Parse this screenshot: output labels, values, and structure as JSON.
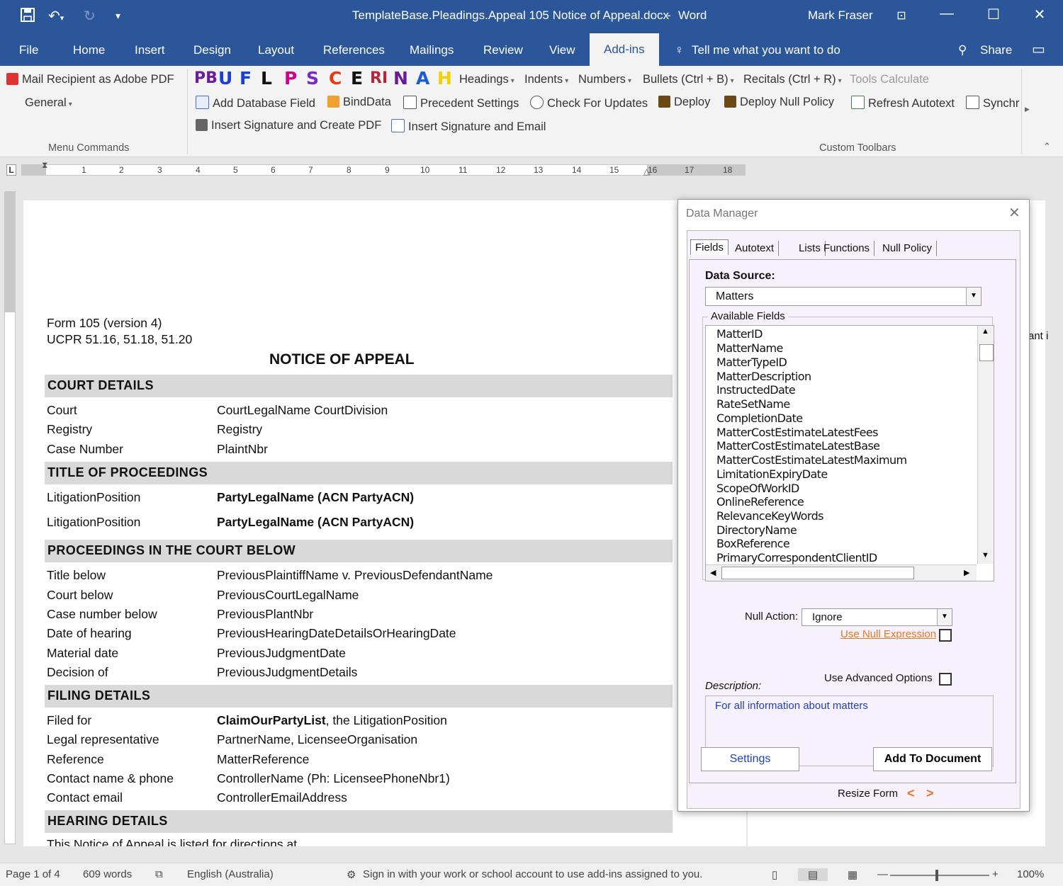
{
  "window": {
    "title": "TemplateBase.Pleadings.Appeal 105 Notice of Appeal.docx",
    "app": "Word",
    "user": "Mark Fraser"
  },
  "tabs": [
    "File",
    "Home",
    "Insert",
    "Design",
    "Layout",
    "References",
    "Mailings",
    "Review",
    "View",
    "Add-ins"
  ],
  "active_tab": "Add-ins",
  "tellme": "Tell me what you want to do",
  "share": "Share",
  "ribbon": {
    "menu_commands": {
      "mail_recipient": "Mail Recipient as Adobe PDF",
      "general": "General",
      "label": "Menu Commands"
    },
    "letters": [
      "PB",
      "U",
      "F",
      "L",
      "P",
      "S",
      "C",
      "E",
      "RI",
      "N",
      "A",
      "H"
    ],
    "row1": {
      "headings": "Headings",
      "indents": "Indents",
      "numbers": "Numbers",
      "bullets": "Bullets (Ctrl + B)",
      "recitals": "Recitals (Ctrl + R)",
      "tools_calculate": "Tools Calculate"
    },
    "row2": {
      "add_db_field": "Add Database Field",
      "bind_data": "BindData",
      "precedent_settings": "Precedent Settings",
      "check_updates": "Check For Updates",
      "deploy": "Deploy",
      "deploy_null": "Deploy Null Policy",
      "refresh_autotext": "Refresh Autotext",
      "synch": "Synchr"
    },
    "row3": {
      "insert_sig_pdf": "Insert Signature and Create PDF",
      "insert_sig_email": "Insert Signature and Email"
    },
    "custom_label": "Custom Toolbars"
  },
  "ruler_numbers": [
    "1",
    "2",
    "3",
    "4",
    "5",
    "6",
    "7",
    "8",
    "9",
    "10",
    "11",
    "12",
    "13",
    "14",
    "15",
    "16",
    "17",
    "18"
  ],
  "document": {
    "form_line1": "Form 105 (version 4)",
    "form_line2": "UCPR 51.16, 51.18, 51.20",
    "title": "NOTICE OF APPEAL",
    "sections": {
      "court_details": "COURT DETAILS",
      "title_of_proceedings": "TITLE OF PROCEEDINGS",
      "court_below": "PROCEEDINGS IN THE COURT BELOW",
      "filing": "FILING DETAILS",
      "hearing": "HEARING DETAILS"
    },
    "court": [
      {
        "label": "Court",
        "value": "CourtLegalName CourtDivision"
      },
      {
        "label": "Registry",
        "value": "Registry"
      },
      {
        "label": "Case Number",
        "value": "PlaintNbr"
      }
    ],
    "parties": [
      {
        "label": "LitigationPosition",
        "value": "PartyLegalName (ACN PartyACN)"
      },
      {
        "label": "LitigationPosition",
        "value": "PartyLegalName (ACN PartyACN)"
      }
    ],
    "below": [
      {
        "label": "Title below",
        "value": "PreviousPlaintiffName v. PreviousDefendantName"
      },
      {
        "label": "Court below",
        "value": "PreviousCourtLegalName"
      },
      {
        "label": "Case number below",
        "value": "PreviousPlantNbr"
      },
      {
        "label": "Date of hearing",
        "value": "PreviousHearingDateDetailsOrHearingDate"
      },
      {
        "label": "Material date",
        "value": "PreviousJudgmentDate"
      },
      {
        "label": "Decision of",
        "value": "PreviousJudgmentDetails"
      }
    ],
    "filing": [
      {
        "label": "Filed for",
        "value_bold": "ClaimOurPartyList",
        "value": ", the LitigationPosition"
      },
      {
        "label": "Legal representative",
        "value": "PartnerName, LicenseeOrganisation"
      },
      {
        "label": "Reference",
        "value": "MatterReference"
      },
      {
        "label": "Contact name & phone",
        "value": "ControllerName (Ph:  LicenseePhoneNbr1)"
      },
      {
        "label": "Contact email",
        "value": "ControllerEmailAddress"
      }
    ],
    "hearing_text": "This Notice of Appeal is listed for directions at",
    "right_fragment": "ant i"
  },
  "dialog": {
    "title": "Data Manager",
    "tabs": [
      "Fields",
      "Autotext",
      "Lists",
      "Functions",
      "Null Policy"
    ],
    "data_source_label": "Data Source:",
    "data_source": "Matters",
    "available_fields_label": "Available Fields",
    "fields": [
      "MatterID",
      "MatterName",
      "MatterTypeID",
      "MatterDescription",
      "InstructedDate",
      "RateSetName",
      "CompletionDate",
      "MatterCostEstimateLatestFees",
      "MatterCostEstimateLatestBase",
      "MatterCostEstimateLatestMaximum",
      "LimitationExpiryDate",
      "ScopeOfWorkID",
      "OnlineReference",
      "RelevanceKeyWords",
      "DirectoryName",
      "BoxReference",
      "PrimaryCorrespondentClientID"
    ],
    "null_action_label": "Null Action:",
    "null_action": "Ignore",
    "use_null_expression": "Use Null Expression",
    "use_advanced": "Use Advanced Options",
    "description_label": "Description:",
    "description": "For all information about matters",
    "settings": "Settings",
    "add_to_document": "Add To Document",
    "resize_form": "Resize Form",
    "resize_left": "<",
    "resize_right": ">"
  },
  "status": {
    "page": "Page 1 of 4",
    "words": "609 words",
    "language": "English (Australia)",
    "signin": "Sign in with your work or school account to use add-ins assigned to you.",
    "zoom": "100%"
  },
  "colors": {
    "word_blue": "#2b579a",
    "link_orange": "#e87722",
    "desc_blue": "#1f3fbf"
  }
}
